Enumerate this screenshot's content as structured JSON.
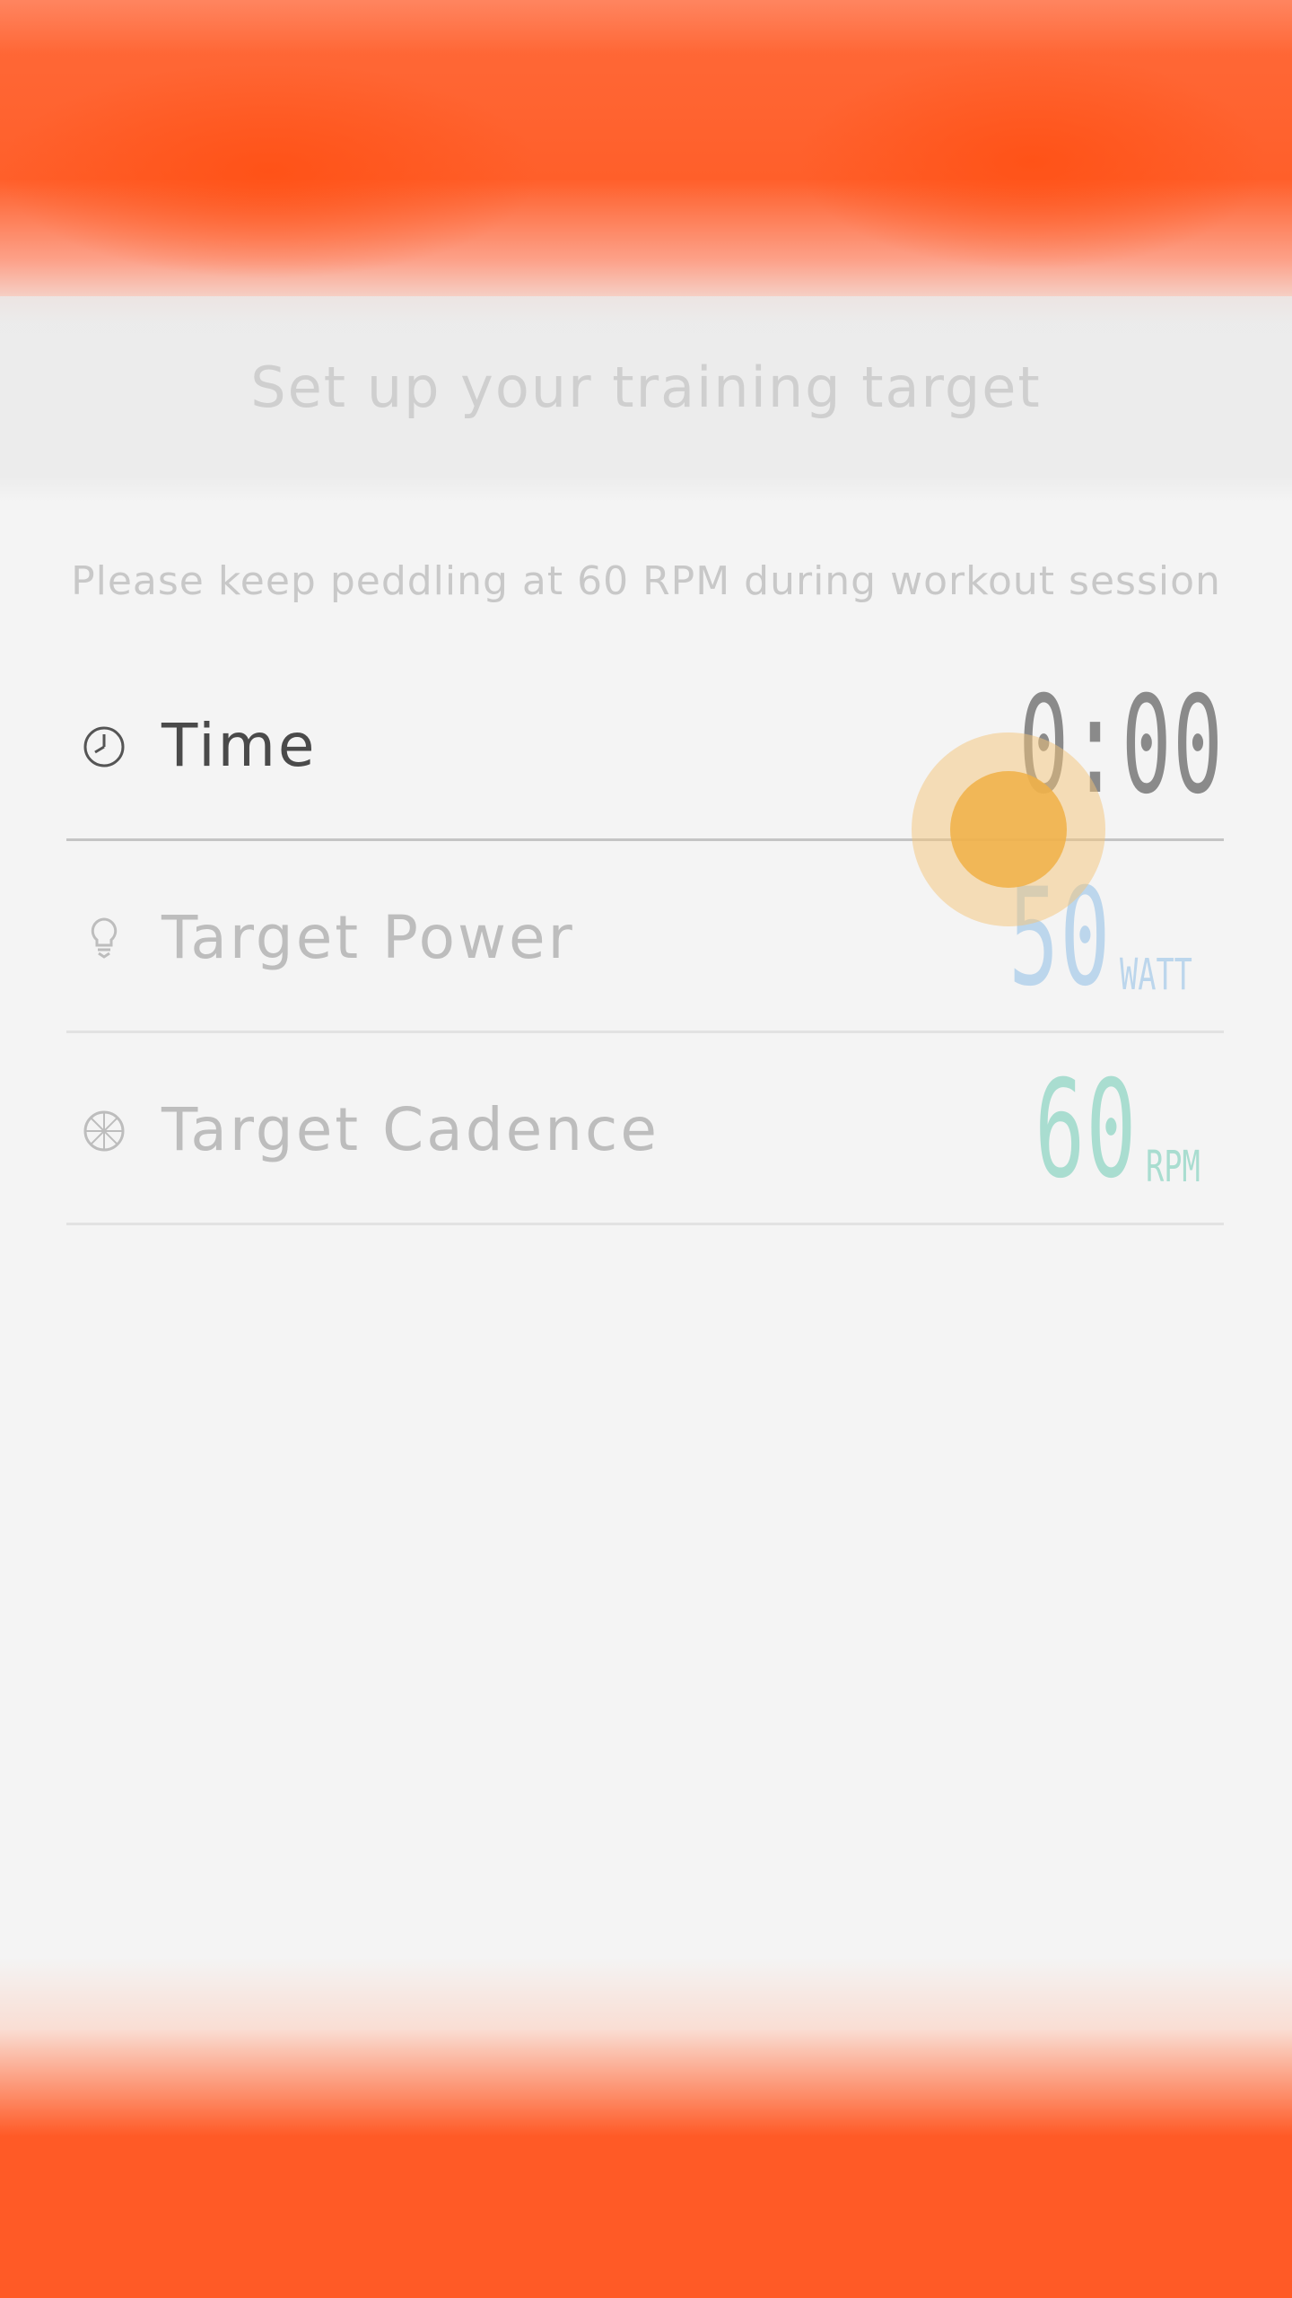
{
  "title": "Set up your training target",
  "hint": "Please keep peddling at 60 RPM during workout session",
  "rows": [
    {
      "label": "Time",
      "value": "0:00",
      "unit": "",
      "icon": "clock-icon",
      "color": "#8a8a8a"
    },
    {
      "label": "Target Power",
      "value": "50",
      "unit": "WATT",
      "icon": "lightbulb-icon",
      "color": "#bcd6ec"
    },
    {
      "label": "Target Cadence",
      "value": "60",
      "unit": "RPM",
      "icon": "wheel-icon",
      "color": "#a9ddd0"
    }
  ],
  "accent": "#ff5a26"
}
